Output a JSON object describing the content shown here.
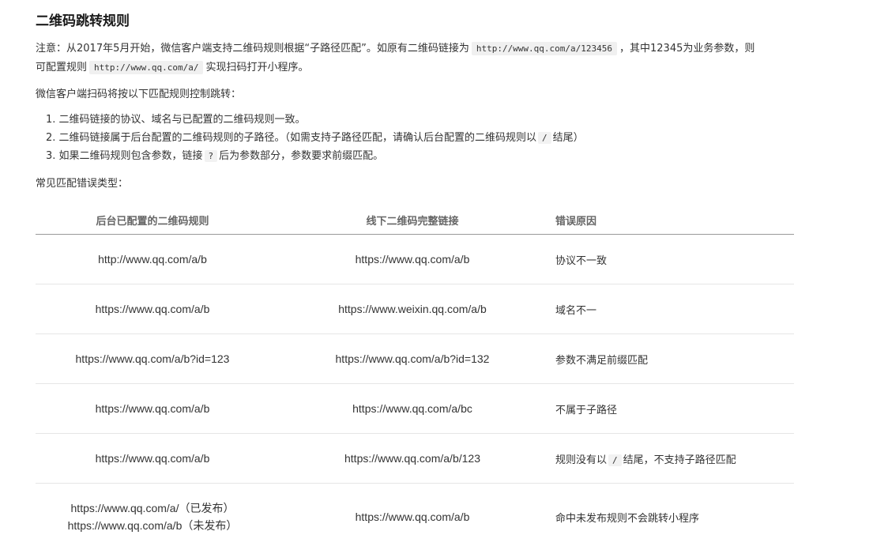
{
  "title": "二维码跳转规则",
  "intro": {
    "part1": "注意：从2017年5月开始，微信客户端支持二维码规则根据“子路径匹配”。如原有二维码链接为",
    "code1": "http://www.qq.com/a/123456",
    "part2": "，其中12345为业务参数，则",
    "part3": "可配置规则",
    "code2": "http://www.qq.com/a/",
    "part4": "实现扫码打开小程序。"
  },
  "control_text": "微信客户端扫码将按以下匹配规则控制跳转：",
  "rules": [
    {
      "text": "1. 二维码链接的协议、域名与已配置的二维码规则一致。"
    },
    {
      "text_before": "2. 二维码链接属于后台配置的二维码规则的子路径。（如需支持子路径匹配，请确认后台配置的二维码规则以",
      "code": "/",
      "text_after": "结尾）"
    },
    {
      "text_before": "3. 如果二维码规则包含参数，链接",
      "code": "?",
      "text_after": "后为参数部分，参数要求前缀匹配。"
    }
  ],
  "common_errors_label": "常见匹配错误类型：",
  "table": {
    "headers": [
      "后台已配置的二维码规则",
      "线下二维码完整链接",
      "错误原因"
    ],
    "rows": [
      {
        "rule": "http://www.qq.com/a/b",
        "link": "https://www.qq.com/a/b",
        "reason": "协议不一致"
      },
      {
        "rule": "https://www.qq.com/a/b",
        "link": "https://www.weixin.qq.com/a/b",
        "reason": "域名不一"
      },
      {
        "rule": "https://www.qq.com/a/b?id=123",
        "link": "https://www.qq.com/a/b?id=132",
        "reason": "参数不满足前缀匹配"
      },
      {
        "rule": "https://www.qq.com/a/b",
        "link": "https://www.qq.com/a/bc",
        "reason": "不属于子路径"
      },
      {
        "rule": "https://www.qq.com/a/b",
        "link": "https://www.qq.com/a/b/123",
        "reason_before": "规则没有以",
        "reason_code": "/",
        "reason_after": "结尾，不支持子路径匹配"
      },
      {
        "rule_line1": "https://www.qq.com/a/（已发布）",
        "rule_line2": "https://www.qq.com/a/b（未发布）",
        "link": "https://www.qq.com/a/b",
        "reason": "命中未发布规则不会跳转小程序"
      }
    ]
  }
}
